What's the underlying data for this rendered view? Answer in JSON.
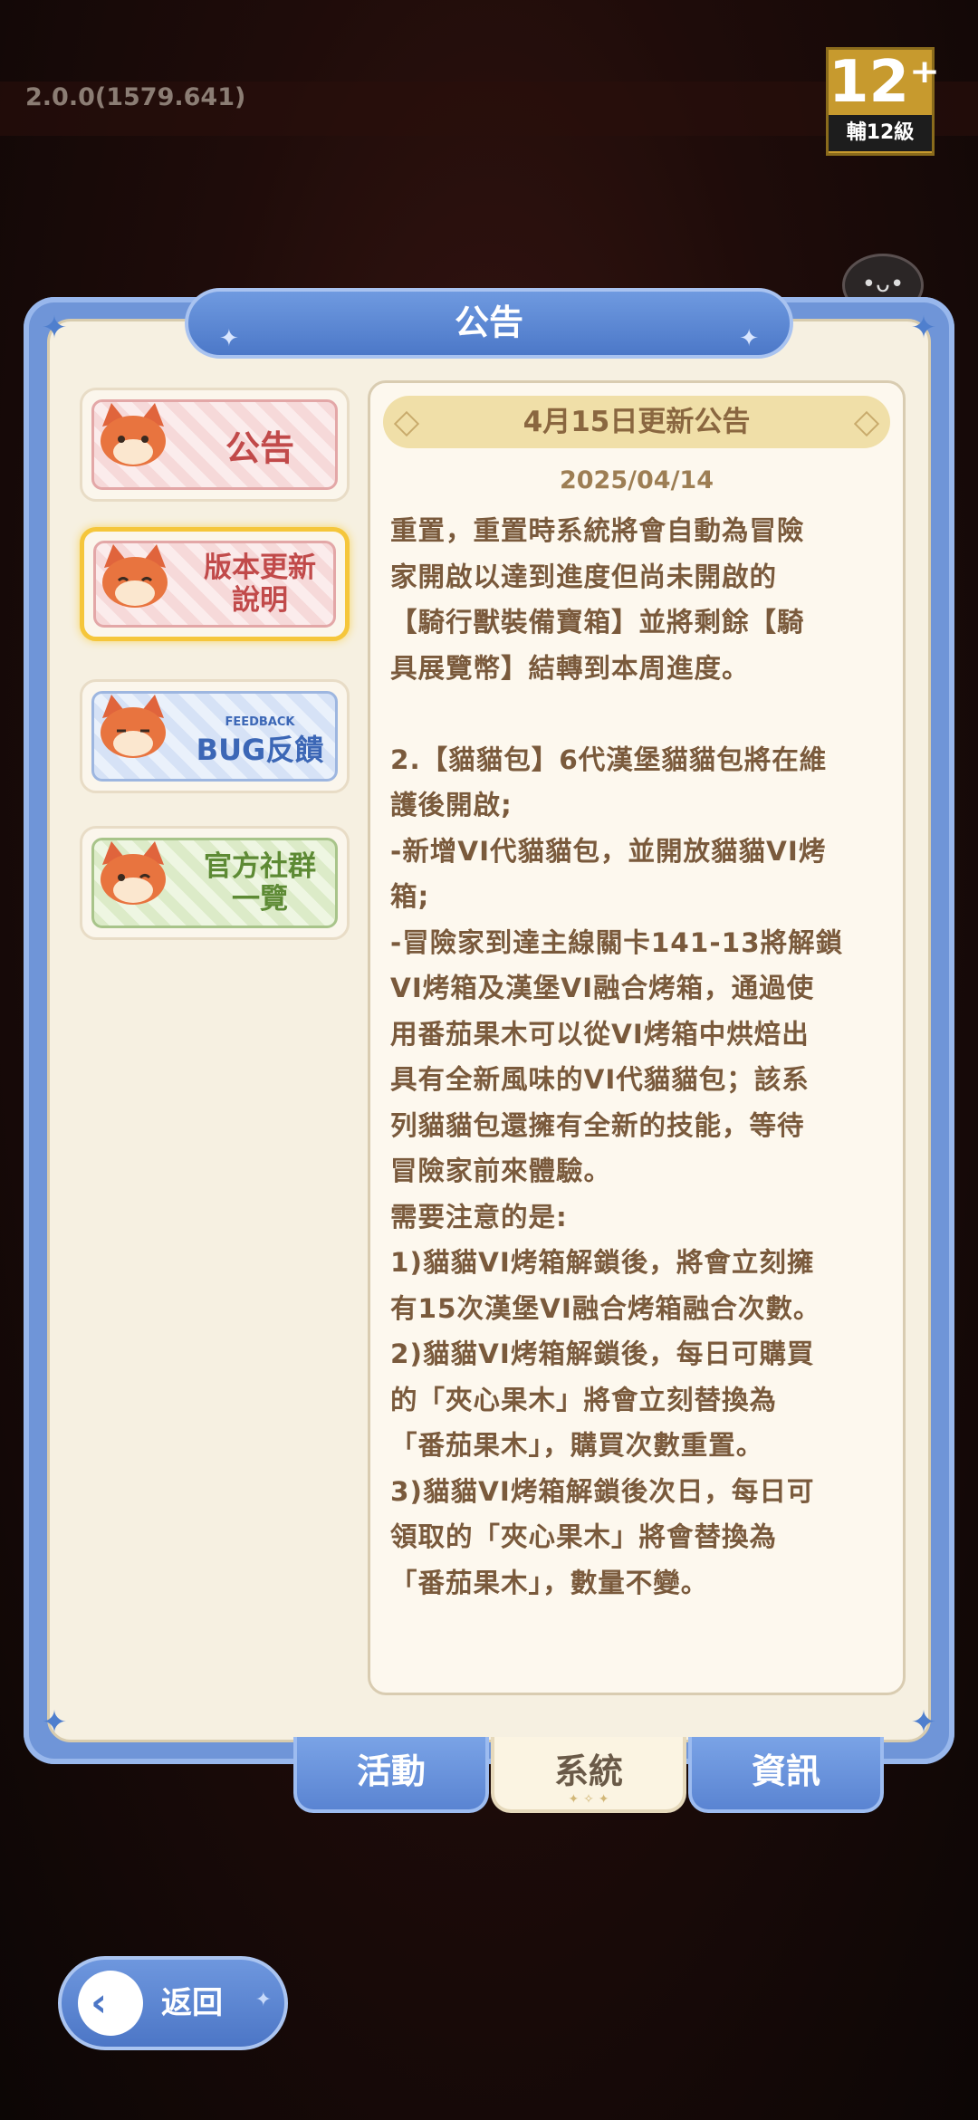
{
  "version": "2.0.0(1579.641)",
  "rating": {
    "number": "12⁺",
    "label": "輔12級"
  },
  "panel": {
    "title": "公告",
    "side_items": [
      {
        "label_line1": "公告",
        "label_line2": "",
        "color": "#c14a4a",
        "selected": false
      },
      {
        "label_line1": "版本更新",
        "label_line2": "說明",
        "color": "#c14a4a",
        "selected": true
      },
      {
        "label_line1": "FEEDBACK",
        "label_line2": "BUG反饋",
        "color": "#3c67b6",
        "selected": false
      },
      {
        "label_line1": "官方社群",
        "label_line2": "一覽",
        "color": "#5d8a34",
        "selected": false
      }
    ]
  },
  "announcement": {
    "title": "4月15日更新公告",
    "date": "2025/04/14",
    "lines": [
      "重置，重置時系統將會自動為冒險",
      "家開啟以達到進度但尚未開啟的",
      "【騎行獸裝備寶箱】並將剩餘【騎",
      "具展覽幣】結轉到本周進度。",
      "",
      "2.【貓貓包】6代漢堡貓貓包將在維",
      "護後開啟;",
      "-新增VI代貓貓包，並開放貓貓VI烤",
      "箱;",
      "-冒險家到達主線關卡141-13將解鎖",
      "VI烤箱及漢堡VI融合烤箱，通過使",
      "用番茄果木可以從VI烤箱中烘焙出",
      "具有全新風味的VI代貓貓包；該系",
      "列貓貓包還擁有全新的技能，等待",
      "冒險家前來體驗。",
      "需要注意的是:",
      "1)貓貓VI烤箱解鎖後，將會立刻擁",
      "有15次漢堡VI融合烤箱融合次數。",
      "2)貓貓VI烤箱解鎖後，每日可購買",
      "的「夾心果木」將會立刻替換為",
      "「番茄果木」，購買次數重置。",
      "3)貓貓VI烤箱解鎖後次日，每日可",
      "領取的「夾心果木」將會替換為",
      "「番茄果木」，數量不變。"
    ]
  },
  "tabs": [
    {
      "label": "活動",
      "active": false
    },
    {
      "label": "系統",
      "active": true
    },
    {
      "label": "資訊",
      "active": false
    }
  ],
  "back_button": {
    "label": "返回"
  }
}
